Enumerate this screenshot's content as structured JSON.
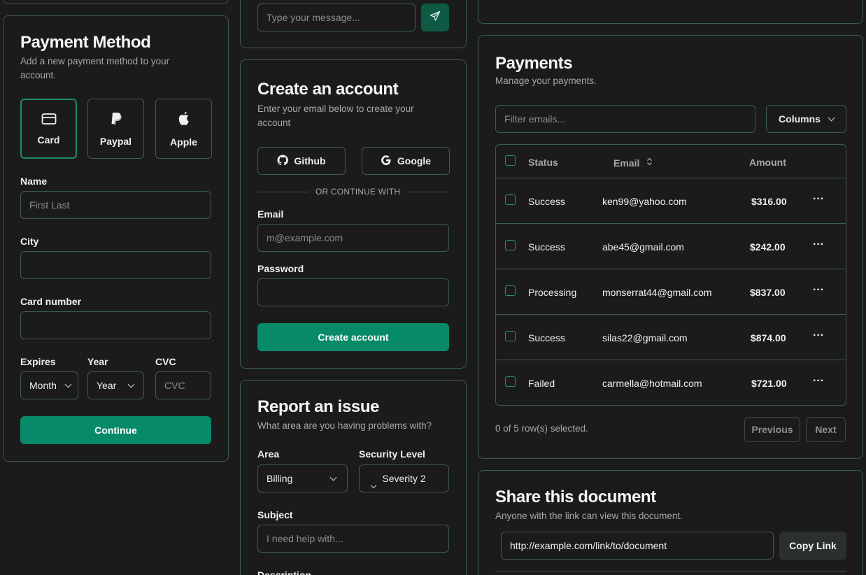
{
  "payment": {
    "title": "Payment Method",
    "description": "Add a new payment method to your account.",
    "options": [
      {
        "label": "Card",
        "icon": "card-icon"
      },
      {
        "label": "Paypal",
        "icon": "paypal-icon"
      },
      {
        "label": "Apple",
        "icon": "apple-icon"
      }
    ],
    "name_label": "Name",
    "name_placeholder": "First Last",
    "city_label": "City",
    "card_number_label": "Card number",
    "expires_label": "Expires",
    "year_label": "Year",
    "cvc_label": "CVC",
    "month_value": "Month",
    "year_value": "Year",
    "cvc_placeholder": "CVC",
    "continue_label": "Continue"
  },
  "chat": {
    "message_placeholder": "Type your message..."
  },
  "account": {
    "title": "Create an account",
    "description": "Enter your email below to create your account",
    "github_label": "Github",
    "google_label": "Google",
    "divider_label": "OR CONTINUE WITH",
    "email_label": "Email",
    "email_placeholder": "m@example.com",
    "password_label": "Password",
    "create_label": "Create account"
  },
  "issue": {
    "title": "Report an issue",
    "description": "What area are you having problems with?",
    "area_label": "Area",
    "area_value": "Billing",
    "security_label": "Security Level",
    "security_value": "Severity 2",
    "subject_label": "Subject",
    "subject_placeholder": "I need help with...",
    "description_label": "Description"
  },
  "payments": {
    "title": "Payments",
    "description": "Manage your payments.",
    "filter_placeholder": "Filter emails...",
    "columns_label": "Columns",
    "headers": {
      "status": "Status",
      "email": "Email",
      "amount": "Amount"
    },
    "rows": [
      {
        "status": "Success",
        "email": "ken99@yahoo.com",
        "amount": "$316.00"
      },
      {
        "status": "Success",
        "email": "abe45@gmail.com",
        "amount": "$242.00"
      },
      {
        "status": "Processing",
        "email": "monserrat44@gmail.com",
        "amount": "$837.00"
      },
      {
        "status": "Success",
        "email": "silas22@gmail.com",
        "amount": "$874.00"
      },
      {
        "status": "Failed",
        "email": "carmella@hotmail.com",
        "amount": "$721.00"
      }
    ],
    "selection_text": "0 of 5 row(s) selected.",
    "previous_label": "Previous",
    "next_label": "Next",
    "row_menu_glyph": "···"
  },
  "share": {
    "title": "Share this document",
    "description": "Anyone with the link can view this document.",
    "link_value": "http://example.com/link/to/document",
    "copy_label": "Copy Link"
  },
  "colors": {
    "accent": "#068a68",
    "border": "#3c5a4e",
    "background": "#1b1b1b"
  }
}
